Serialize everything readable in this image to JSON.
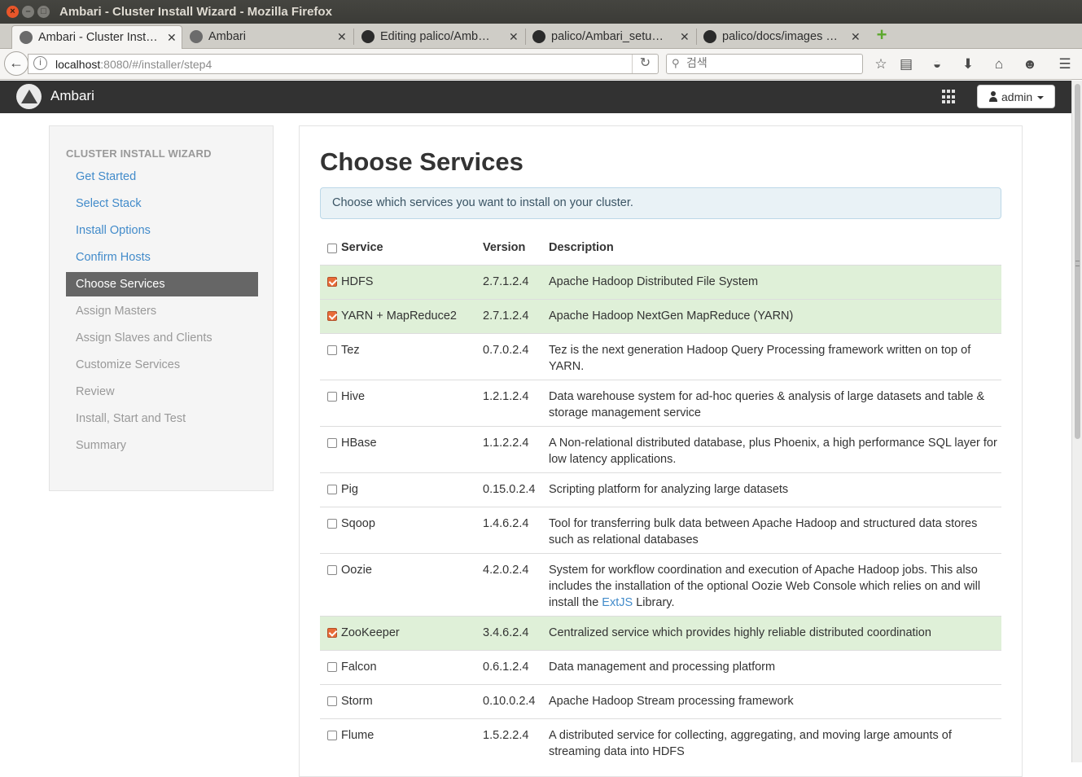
{
  "window": {
    "title": "Ambari - Cluster Install Wizard - Mozilla Firefox"
  },
  "tabs": [
    {
      "label": "Ambari - Cluster Inst…",
      "active": true
    },
    {
      "label": "Ambari",
      "active": false
    },
    {
      "label": "Editing palico/Amb…",
      "active": false
    },
    {
      "label": "palico/Ambari_setu…",
      "active": false
    },
    {
      "label": "palico/docs/images …",
      "active": false
    }
  ],
  "browser": {
    "url_host": "localhost",
    "url_rest": ":8080/#/installer/step4",
    "search_placeholder": "검색"
  },
  "app": {
    "name": "Ambari",
    "user_label": "admin"
  },
  "sidebar": {
    "header": "CLUSTER INSTALL WIZARD",
    "steps": [
      {
        "label": "Get Started",
        "state": "done"
      },
      {
        "label": "Select Stack",
        "state": "done"
      },
      {
        "label": "Install Options",
        "state": "done"
      },
      {
        "label": "Confirm Hosts",
        "state": "done"
      },
      {
        "label": "Choose Services",
        "state": "active"
      },
      {
        "label": "Assign Masters",
        "state": "todo"
      },
      {
        "label": "Assign Slaves and Clients",
        "state": "todo"
      },
      {
        "label": "Customize Services",
        "state": "todo"
      },
      {
        "label": "Review",
        "state": "todo"
      },
      {
        "label": "Install, Start and Test",
        "state": "todo"
      },
      {
        "label": "Summary",
        "state": "todo"
      }
    ]
  },
  "main": {
    "title": "Choose Services",
    "alert": "Choose which services you want to install on your cluster.",
    "columns": {
      "service": "Service",
      "version": "Version",
      "description": "Description"
    },
    "services": [
      {
        "name": "HDFS",
        "version": "2.7.1.2.4",
        "description": "Apache Hadoop Distributed File System",
        "checked": true
      },
      {
        "name": "YARN + MapReduce2",
        "version": "2.7.1.2.4",
        "description": "Apache Hadoop NextGen MapReduce (YARN)",
        "checked": true
      },
      {
        "name": "Tez",
        "version": "0.7.0.2.4",
        "description": "Tez is the next generation Hadoop Query Processing framework written on top of YARN.",
        "checked": false
      },
      {
        "name": "Hive",
        "version": "1.2.1.2.4",
        "description": "Data warehouse system for ad-hoc queries & analysis of large datasets and table & storage management service",
        "checked": false
      },
      {
        "name": "HBase",
        "version": "1.1.2.2.4",
        "description": "A Non-relational distributed database, plus Phoenix, a high performance SQL layer for low latency applications.",
        "checked": false
      },
      {
        "name": "Pig",
        "version": "0.15.0.2.4",
        "description": "Scripting platform for analyzing large datasets",
        "checked": false
      },
      {
        "name": "Sqoop",
        "version": "1.4.6.2.4",
        "description": "Tool for transferring bulk data between Apache Hadoop and structured data stores such as relational databases",
        "checked": false
      },
      {
        "name": "Oozie",
        "version": "4.2.0.2.4",
        "description": "System for workflow coordination and execution of Apache Hadoop jobs. This also includes the installation of the optional Oozie Web Console which relies on and will install the ",
        "link": "ExtJS",
        "description_end": " Library.",
        "checked": false
      },
      {
        "name": "ZooKeeper",
        "version": "3.4.6.2.4",
        "description": "Centralized service which provides highly reliable distributed coordination",
        "checked": true
      },
      {
        "name": "Falcon",
        "version": "0.6.1.2.4",
        "description": "Data management and processing platform",
        "checked": false
      },
      {
        "name": "Storm",
        "version": "0.10.0.2.4",
        "description": "Apache Hadoop Stream processing framework",
        "checked": false
      },
      {
        "name": "Flume",
        "version": "1.5.2.2.4",
        "description": "A distributed service for collecting, aggregating, and moving large amounts of streaming data into HDFS",
        "checked": false
      }
    ]
  },
  "colors": {
    "selected_row": "#dff0d8",
    "link": "#428bca",
    "header_bar": "#323232",
    "checkbox_on": "#e86c38"
  }
}
